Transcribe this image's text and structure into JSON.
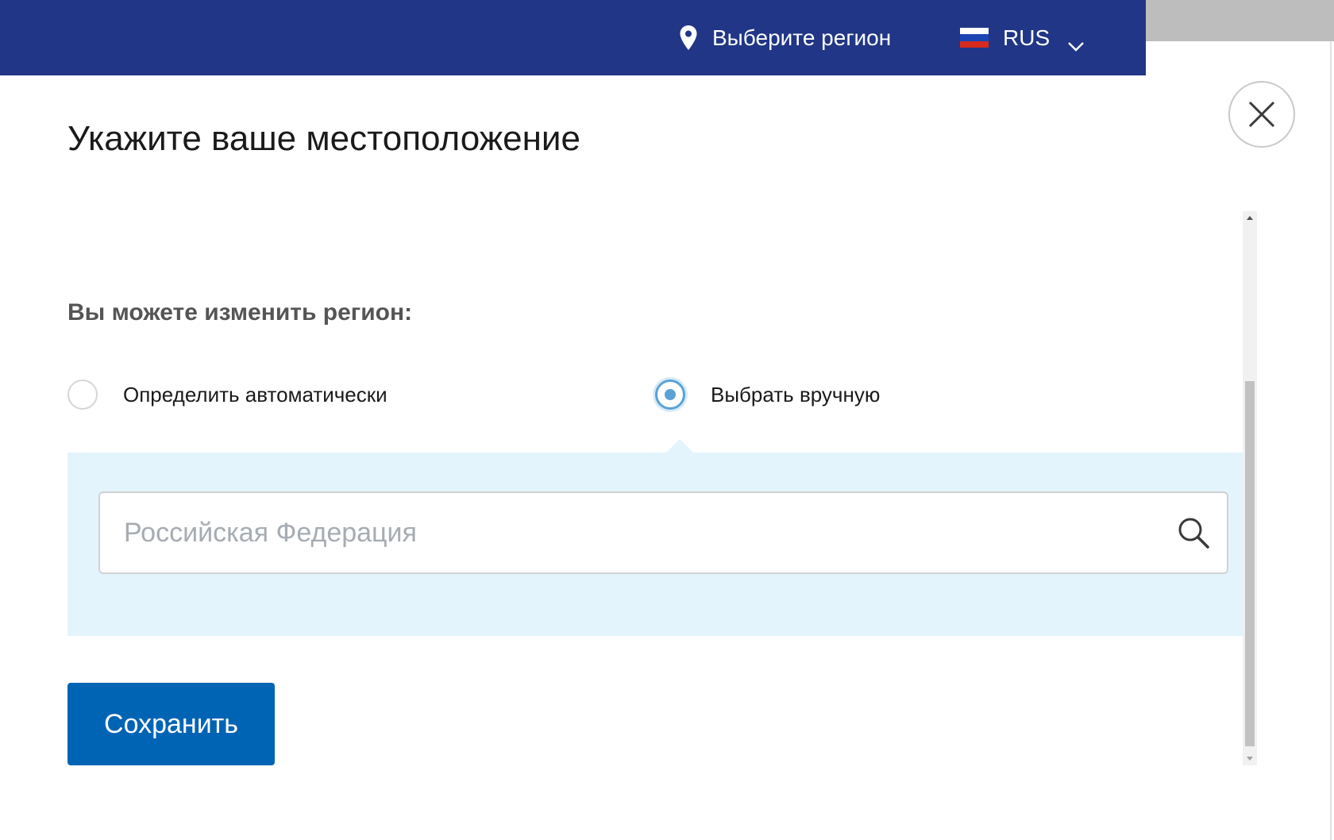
{
  "header": {
    "region_label": "Выберите регион",
    "language_label": "RUS"
  },
  "modal": {
    "title": "Укажите ваше местоположение",
    "subtitle": "Вы можете изменить регион:",
    "options": [
      {
        "label": "Определить автоматически",
        "checked": false
      },
      {
        "label": "Выбрать вручную",
        "checked": true
      }
    ],
    "search": {
      "value": "",
      "placeholder": "Российская Федерация"
    },
    "save_label": "Сохранить"
  },
  "icons": {
    "close": "close-icon",
    "pin": "map-pin-icon",
    "flag": "russia-flag-icon",
    "chevron": "chevron-down-icon",
    "search": "search-icon"
  },
  "colors": {
    "header_bg": "#213686",
    "accent": "#0064b5",
    "panel_bg": "#e3f4fd",
    "radio_checked": "#5aa1d6"
  }
}
